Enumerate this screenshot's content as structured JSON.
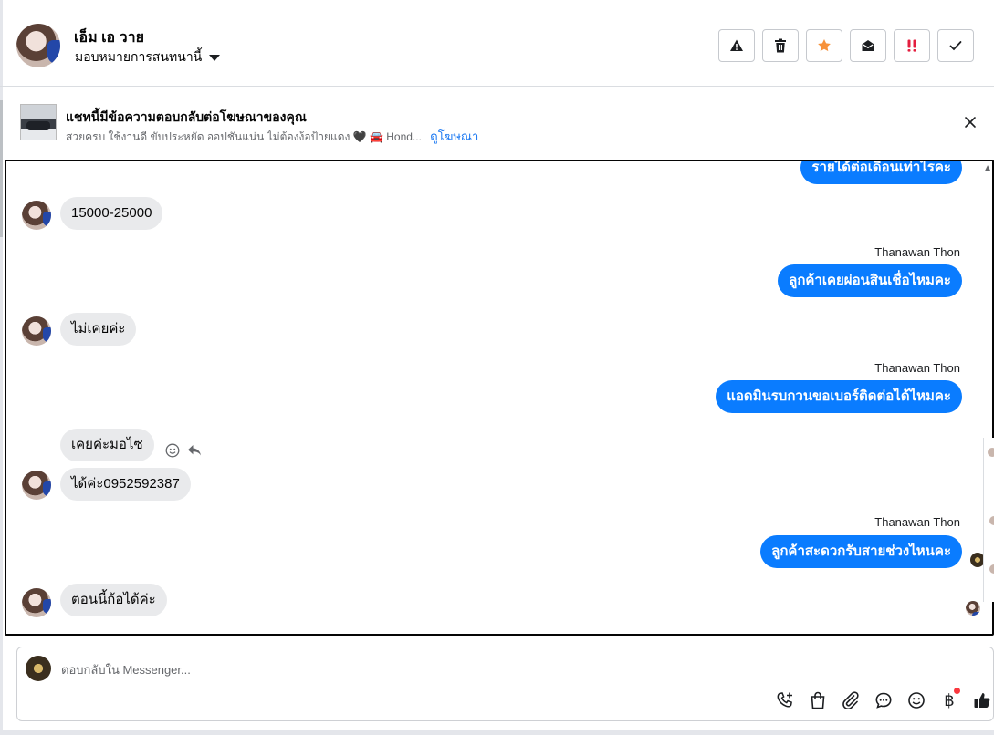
{
  "header": {
    "contact_name": "เอ็ม เอ วาย",
    "assign_label": "มอบหมายการสนทนานี้"
  },
  "ad_banner": {
    "title": "แชทนี้มีข้อความตอบกลับต่อโฆษณาของคุณ",
    "description": "สวยครบ ใช้งานดี ขับประหยัด ออปชันแน่น ไม่ต้องง้อป้ายแดง 🖤 🚘 Hond...",
    "link": "ดูโฆษณา"
  },
  "messages": [
    {
      "side": "out",
      "text": "รายได้ต่อเดือนเท่าไรคะ"
    },
    {
      "side": "in",
      "text": "15000-25000"
    },
    {
      "side": "out",
      "sender": "Thanawan Thon",
      "text": "ลูกค้าเคยผ่อนสินเชื่อไหมคะ"
    },
    {
      "side": "in",
      "text": "ไม่เคยค่ะ"
    },
    {
      "side": "out",
      "sender": "Thanawan Thon",
      "text": "แอดมินรบกวนขอเบอร์ติดต่อได้ไหมคะ"
    },
    {
      "side": "in",
      "text": "เคยค่ะมอไซ"
    },
    {
      "side": "in",
      "text": "ได้ค่ะ0952592387"
    },
    {
      "side": "out",
      "sender": "Thanawan Thon",
      "text": "ลูกค้าสะดวกรับสายช่วงไหนคะ"
    },
    {
      "side": "in",
      "text": "ตอนนี้ก้อได้ค่ะ"
    }
  ],
  "composer": {
    "placeholder": "ตอบกลับใน Messenger..."
  },
  "colors": {
    "outgoing_bubble": "#0a7cff",
    "incoming_bubble": "#e9eaec",
    "link": "#1877f2",
    "star": "#f7923b",
    "important": "#e41e3f",
    "notification_dot": "#fa383e"
  }
}
